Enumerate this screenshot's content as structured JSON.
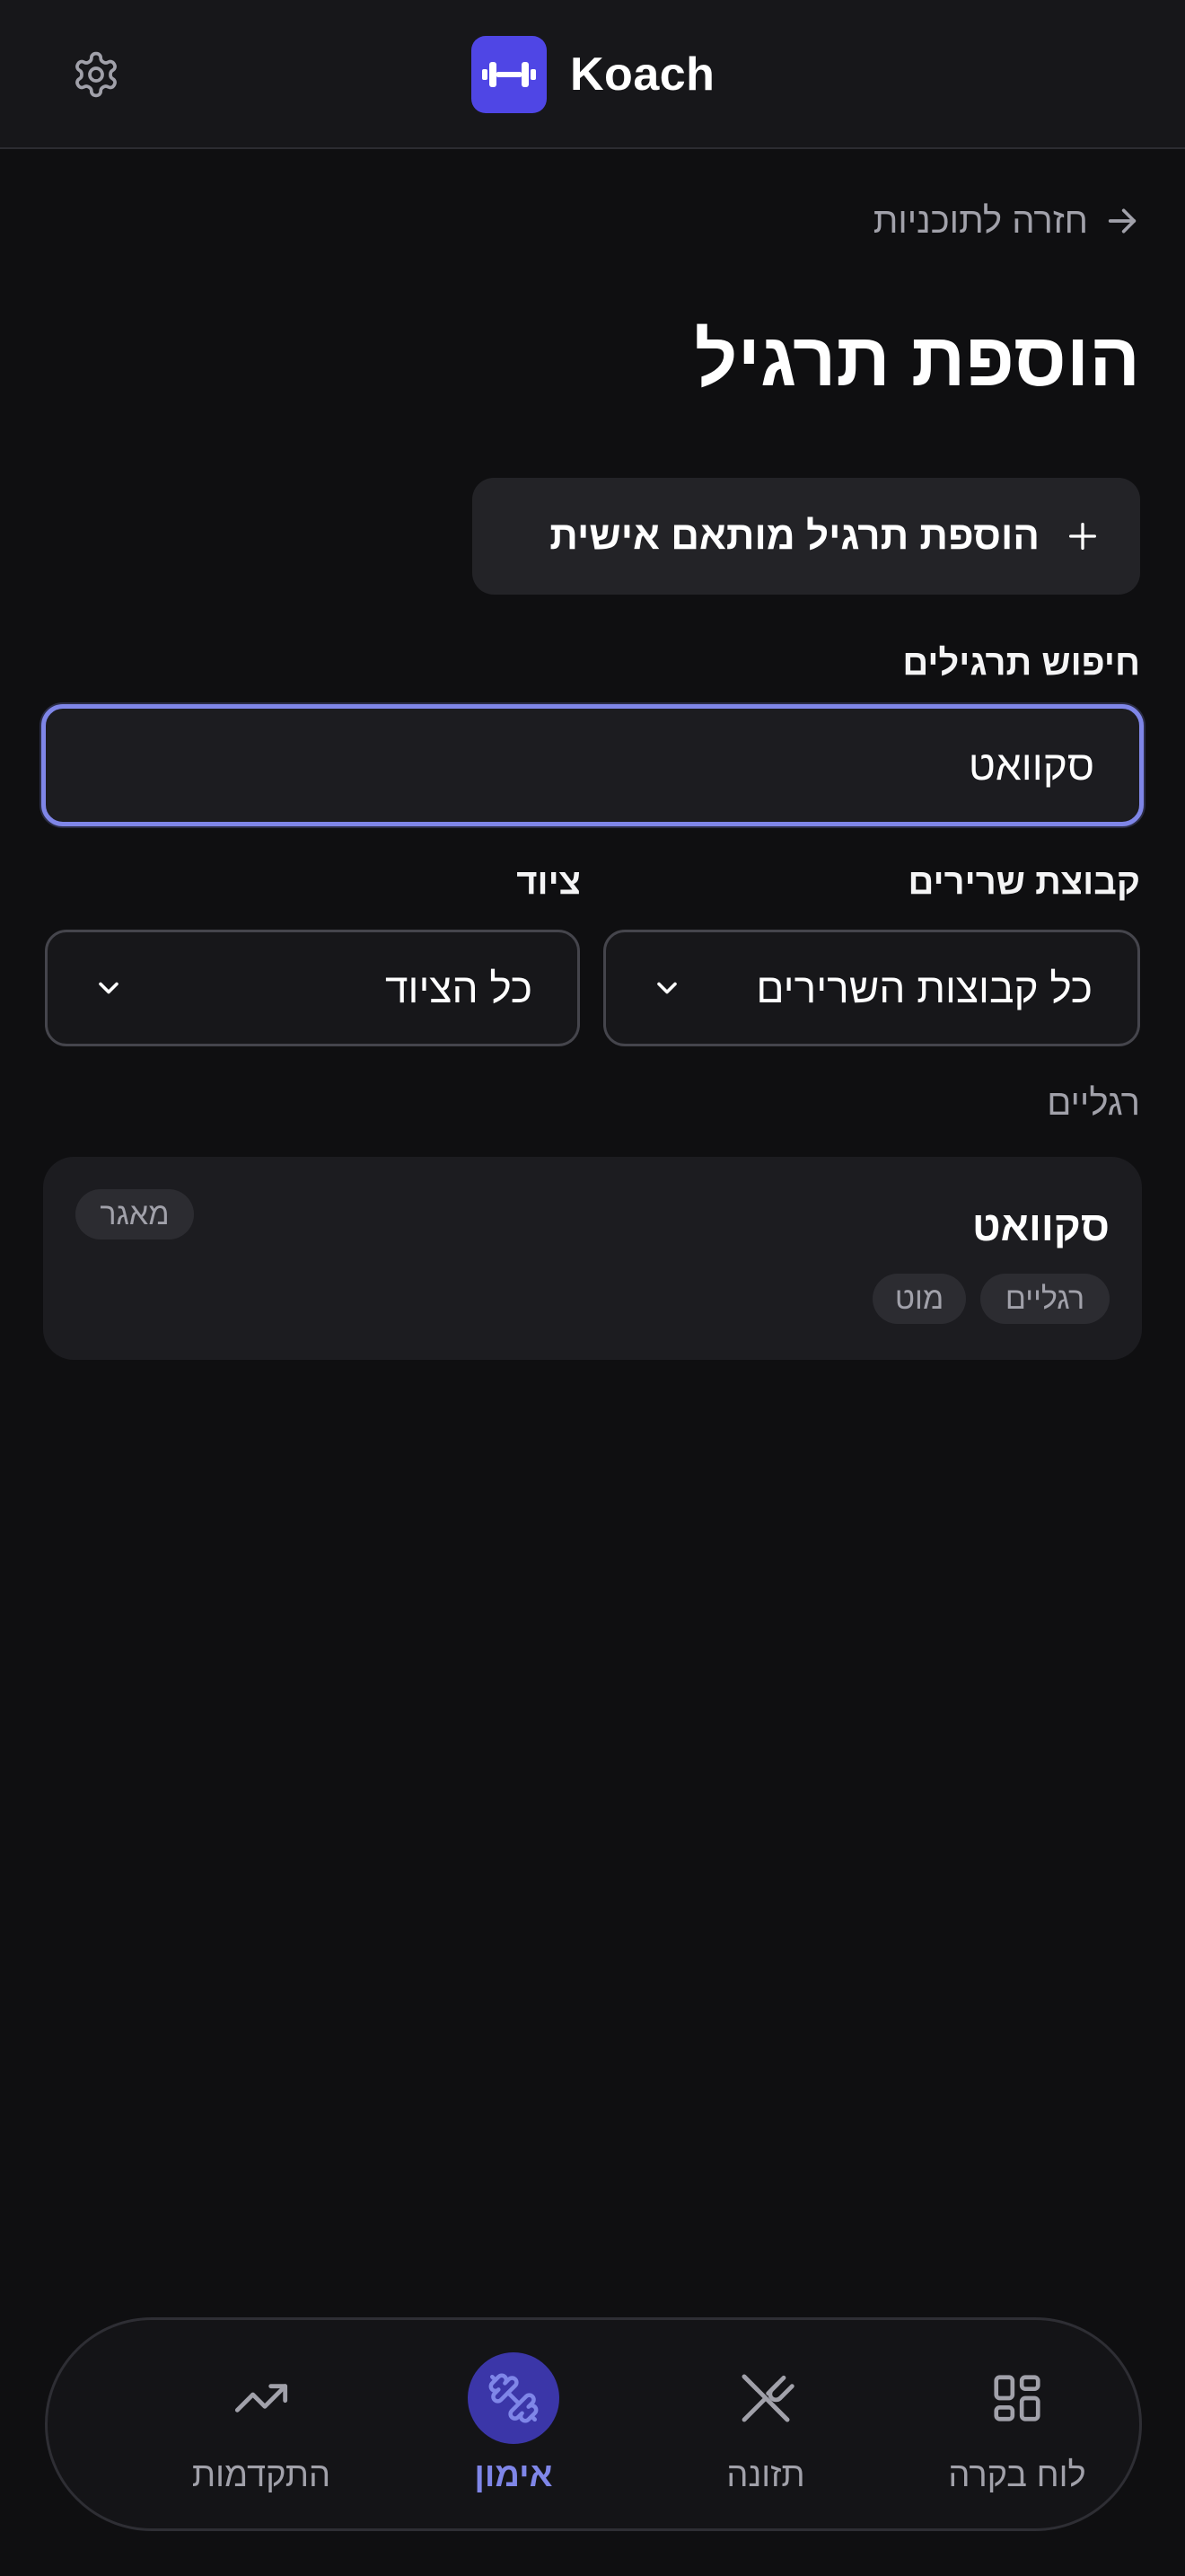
{
  "app": {
    "name": "Koach"
  },
  "icons": {
    "settings": "gear-icon",
    "logo": "dumbbell-icon",
    "back": "arrow-right-icon",
    "add": "plus-icon"
  },
  "back_link": {
    "label": "חזרה לתוכניות"
  },
  "page_title": "הוספת תרגיל",
  "custom_exercise_button": {
    "label": "הוספת תרגיל מותאם אישית"
  },
  "search": {
    "label": "חיפוש תרגילים",
    "value": "סקוואט"
  },
  "filters": {
    "muscle_group": {
      "label": "קבוצת שרירים",
      "value": "כל קבוצות השרירים"
    },
    "equipment": {
      "label": "ציוד",
      "value": "כל הציוד"
    }
  },
  "results": {
    "group_heading": "רגליים",
    "items": [
      {
        "name": "סקוואט",
        "source": "מאגר",
        "tags": [
          "רגליים",
          "מוט"
        ]
      }
    ]
  },
  "bottom_nav": {
    "items": [
      {
        "label": "לוח בקרה",
        "icon": "dashboard-grid-icon",
        "active": false
      },
      {
        "label": "תזונה",
        "icon": "utensils-off-icon",
        "active": false
      },
      {
        "label": "אימון",
        "icon": "dumbbell-icon",
        "active": true
      },
      {
        "label": "התקדמות",
        "icon": "trending-up-icon",
        "active": false
      }
    ]
  },
  "colors": {
    "accent": "#4f46e5",
    "accent_light": "#7f86e8",
    "background": "#0f0f11"
  }
}
